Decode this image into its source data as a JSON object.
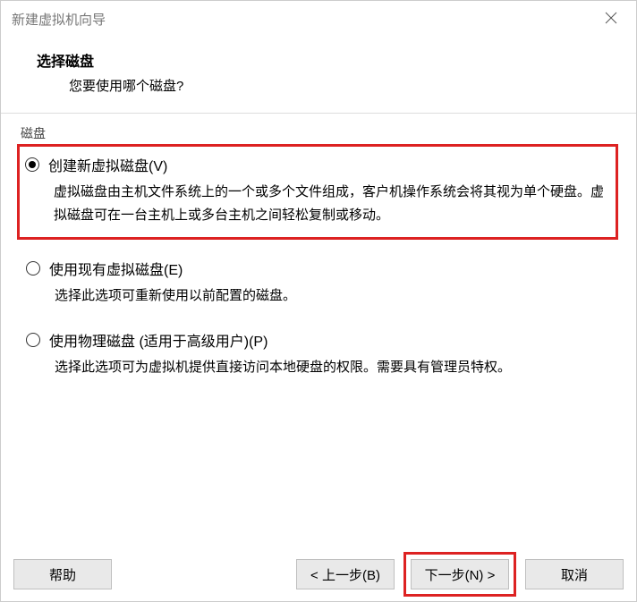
{
  "window": {
    "title": "新建虚拟机向导"
  },
  "header": {
    "title": "选择磁盘",
    "subtitle": "您要使用哪个磁盘?"
  },
  "groupbox": {
    "label": "磁盘"
  },
  "options": {
    "createNew": {
      "label": "创建新虚拟磁盘(V)",
      "desc": "虚拟磁盘由主机文件系统上的一个或多个文件组成，客户机操作系统会将其视为单个硬盘。虚拟磁盘可在一台主机上或多台主机之间轻松复制或移动。"
    },
    "useExisting": {
      "label": "使用现有虚拟磁盘(E)",
      "desc": "选择此选项可重新使用以前配置的磁盘。"
    },
    "usePhysical": {
      "label": "使用物理磁盘 (适用于高级用户)(P)",
      "desc": "选择此选项可为虚拟机提供直接访问本地硬盘的权限。需要具有管理员特权。"
    }
  },
  "buttons": {
    "help": "帮助",
    "back": "< 上一步(B)",
    "next": "下一步(N) >",
    "cancel": "取消"
  }
}
